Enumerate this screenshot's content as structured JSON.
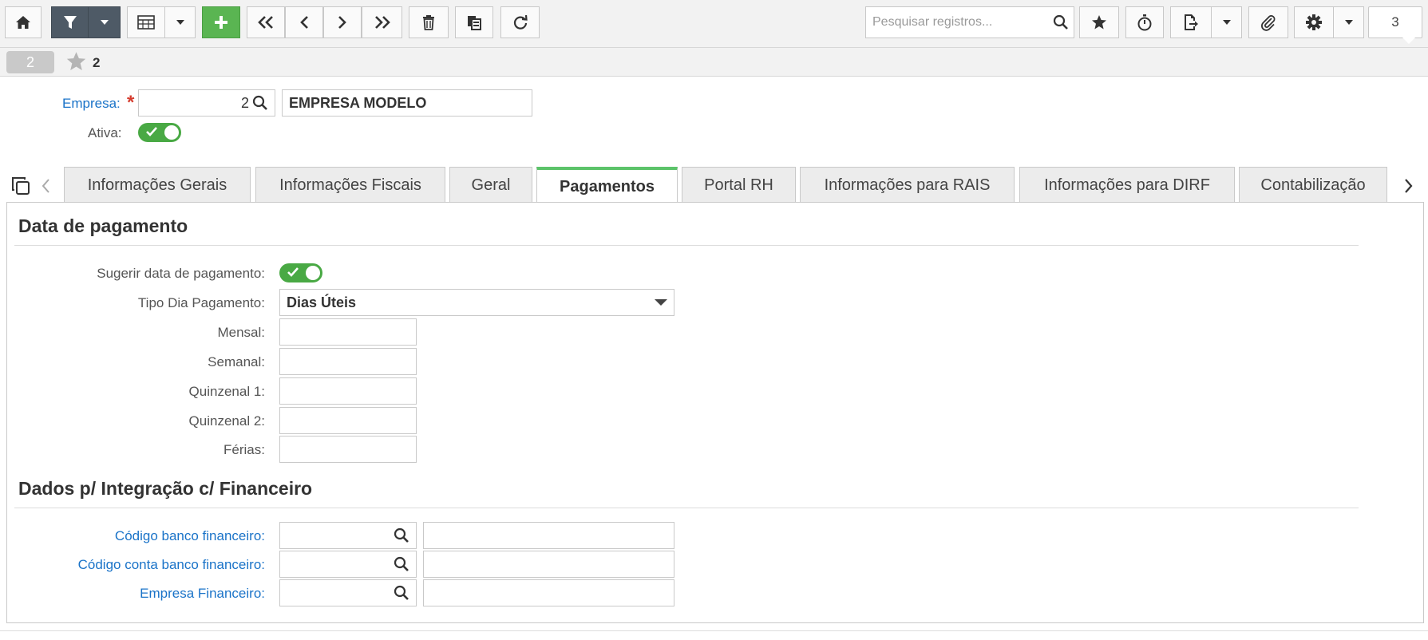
{
  "toolbar": {
    "home_icon": "home-icon",
    "filter_icon": "filter-icon",
    "grid_icon": "table-icon",
    "add_icon": "plus-icon",
    "search_placeholder": "Pesquisar registros...",
    "page_count": "3"
  },
  "record": {
    "id_pill": "2",
    "favorite_count": "2"
  },
  "header": {
    "empresa_label": "Empresa:",
    "empresa_code": "2",
    "empresa_name": "EMPRESA MODELO",
    "ativa_label": "Ativa:",
    "ativa_on": true
  },
  "tabs": [
    {
      "label": "Informações Gerais"
    },
    {
      "label": "Informações Fiscais"
    },
    {
      "label": "Geral"
    },
    {
      "label": "Pagamentos",
      "active": true
    },
    {
      "label": "Portal RH"
    },
    {
      "label": "Informações para RAIS"
    },
    {
      "label": "Informações para DIRF"
    },
    {
      "label": "Contabilização"
    }
  ],
  "payment": {
    "section_title": "Data de pagamento",
    "sugerir_label": "Sugerir data de pagamento:",
    "sugerir_on": true,
    "tipo_label": "Tipo Dia Pagamento:",
    "tipo_value": "Dias Úteis",
    "mensal_label": "Mensal:",
    "mensal_value": "",
    "semanal_label": "Semanal:",
    "semanal_value": "",
    "quinzenal1_label": "Quinzenal 1:",
    "quinzenal1_value": "",
    "quinzenal2_label": "Quinzenal 2:",
    "quinzenal2_value": "",
    "ferias_label": "Férias:",
    "ferias_value": ""
  },
  "financeiro": {
    "section_title": "Dados p/ Integração c/ Financeiro",
    "banco_label": "Código banco financeiro:",
    "banco_code": "",
    "banco_desc": "",
    "conta_label": "Código conta banco financeiro:",
    "conta_code": "",
    "conta_desc": "",
    "empresa_label": "Empresa Financeiro:",
    "empresa_code": "",
    "empresa_desc": ""
  },
  "colors": {
    "accent_green": "#5ab552",
    "toggle_green": "#49a944",
    "active_tab_border": "#5cc36a",
    "link_blue": "#1a73c8",
    "required_red": "#d53c2e",
    "dark_button": "#4e5a66"
  }
}
